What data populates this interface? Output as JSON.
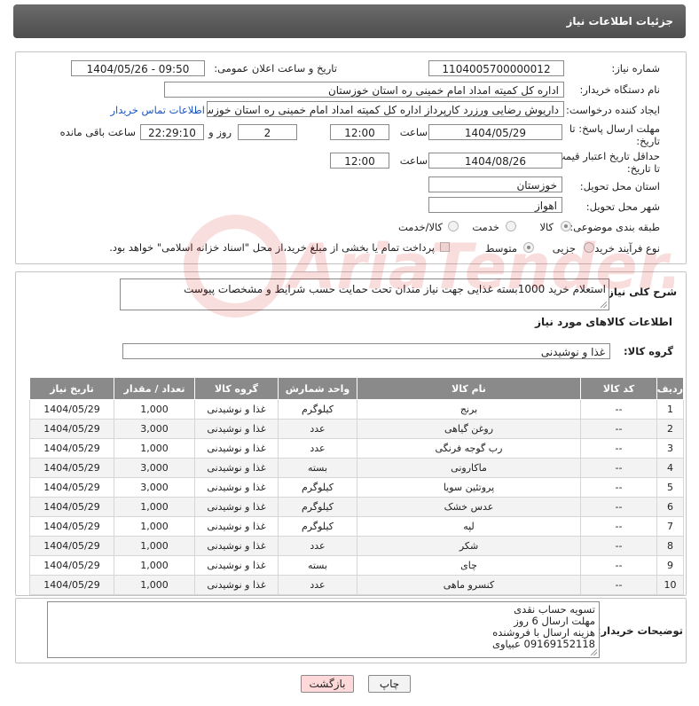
{
  "header": {
    "title": "جزئیات اطلاعات نیاز"
  },
  "form": {
    "need_number_label": "شماره نیاز:",
    "need_number": "1104005700000012",
    "announce_label": "تاریخ و ساعت اعلان عمومی:",
    "announce_value": "1404/05/26 - 09:50",
    "buyer_org_label": "نام دستگاه خریدار:",
    "buyer_org": "اداره کل کمیته امداد امام خمینی  ره  استان خوزستان",
    "creator_label": "ایجاد کننده درخواست:",
    "creator": "داریوش رضایی ورزرد کارپرداز اداره کل کمیته امداد امام خمینی  ره  استان خوزستان",
    "contact_link": "اطلاعات تماس خریدار",
    "deadline_label_1": "مهلت ارسال پاسخ: تا",
    "deadline_label_2": "تاریخ:",
    "deadline_date": "1404/05/29",
    "hour_label": "ساعت",
    "deadline_hour": "12:00",
    "days_value": "2",
    "days_label": "روز و",
    "remaining_time": "22:29:10",
    "remaining_label": "ساعت باقی مانده",
    "validity_label_1": "حداقل تاریخ اعتبار قیمت:",
    "validity_label_2": "تا تاریخ:",
    "validity_date": "1404/08/26",
    "validity_hour": "12:00",
    "province_label": "استان محل تحویل:",
    "province": "خوزستان",
    "city_label": "شهر محل تحویل:",
    "city": "اهواز",
    "category_label": "طبقه بندی موضوعی:",
    "category_options": [
      "کالا",
      "خدمت",
      "کالا/خدمت"
    ],
    "process_label": "نوع فرآیند خرید :",
    "process_options": [
      "جزیی",
      "متوسط"
    ],
    "treasury_note": "پرداخت تمام یا بخشی از مبلغ خرید،از محل \"اسناد خزانه اسلامی\" خواهد بود."
  },
  "description": {
    "label": "شرح کلی نیاز:",
    "text": "استعلام خرید 1000بسته غذایی جهت نیاز مندان تحت حمایت حسب شرایط و مشخصات پیوست"
  },
  "goods": {
    "section_title": "اطلاعات کالاهای مورد نیاز",
    "group_label": "گروه کالا:",
    "group_value": "غذا و نوشیدنی",
    "columns": [
      "ردیف",
      "کد کالا",
      "نام کالا",
      "واحد شمارش",
      "گروه کالا",
      "تعداد / مقدار",
      "تاریخ نیاز"
    ],
    "rows": [
      [
        "1",
        "--",
        "برنج",
        "کیلوگرم",
        "غذا و نوشیدنی",
        "1,000",
        "1404/05/29"
      ],
      [
        "2",
        "--",
        "روغن گیاهی",
        "عدد",
        "غذا و نوشیدنی",
        "3,000",
        "1404/05/29"
      ],
      [
        "3",
        "--",
        "رب گوجه فرنگی",
        "عدد",
        "غذا و نوشیدنی",
        "1,000",
        "1404/05/29"
      ],
      [
        "4",
        "--",
        "ماکارونی",
        "بسته",
        "غذا و نوشیدنی",
        "3,000",
        "1404/05/29"
      ],
      [
        "5",
        "--",
        "پروتئین سویا",
        "کیلوگرم",
        "غذا و نوشیدنی",
        "3,000",
        "1404/05/29"
      ],
      [
        "6",
        "--",
        "عدس خشک",
        "کیلوگرم",
        "غذا و نوشیدنی",
        "1,000",
        "1404/05/29"
      ],
      [
        "7",
        "--",
        "لپه",
        "کیلوگرم",
        "غذا و نوشیدنی",
        "1,000",
        "1404/05/29"
      ],
      [
        "8",
        "--",
        "شکر",
        "عدد",
        "غذا و نوشیدنی",
        "1,000",
        "1404/05/29"
      ],
      [
        "9",
        "--",
        "چای",
        "بسته",
        "غذا و نوشیدنی",
        "1,000",
        "1404/05/29"
      ],
      [
        "10",
        "--",
        "کنسرو ماهی",
        "عدد",
        "غذا و نوشیدنی",
        "1,000",
        "1404/05/29"
      ]
    ]
  },
  "buyer_notes": {
    "label": "توضیحات خریدار:",
    "lines": [
      "تسویه حساب نقدی",
      "مهلت ارسال 6 روز",
      "هزینه ارسال با فروشنده",
      "09169152118 عبیاوی"
    ]
  },
  "actions": {
    "print": "چاپ",
    "back": "بازگشت"
  },
  "watermark": {
    "text": "AriaTender.neT"
  }
}
